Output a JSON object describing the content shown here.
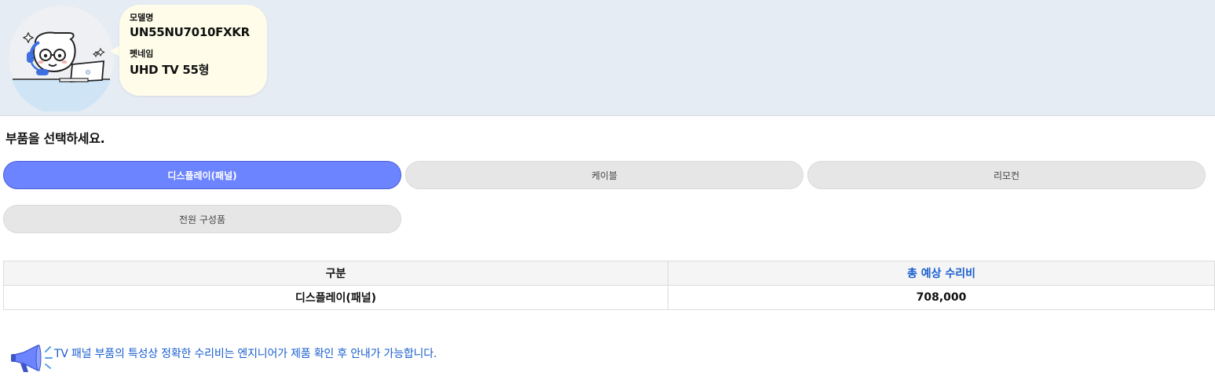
{
  "product": {
    "model_label": "모델명",
    "model_value": "UN55NU7010FXKR",
    "petname_label": "펫네임",
    "petname_value": "UHD TV 55형"
  },
  "section_title": "부품을 선택하세요.",
  "parts": [
    {
      "label": "디스플레이(패널)",
      "active": true
    },
    {
      "label": "케이블",
      "active": false
    },
    {
      "label": "리모컨",
      "active": false
    },
    {
      "label": "전원 구성품",
      "active": false
    }
  ],
  "table": {
    "headers": [
      "구분",
      "총 예상 수리비"
    ],
    "rows": [
      [
        "디스플레이(패널)",
        "708,000"
      ]
    ]
  },
  "notice": "TV 패널 부품의 특성상 정확한 수리비는 엔지니어가 제품 확인 후 안내가 가능합니다.",
  "colors": {
    "active_button": "#6c84ff",
    "cost_header": "#1a5fcf",
    "notice_text": "#1a5fcf",
    "header_band": "#e6ecf4",
    "speech_bubble": "#fffdea"
  },
  "icons": {
    "mascot": "support-agent-mascot-icon",
    "notice": "megaphone-icon"
  }
}
